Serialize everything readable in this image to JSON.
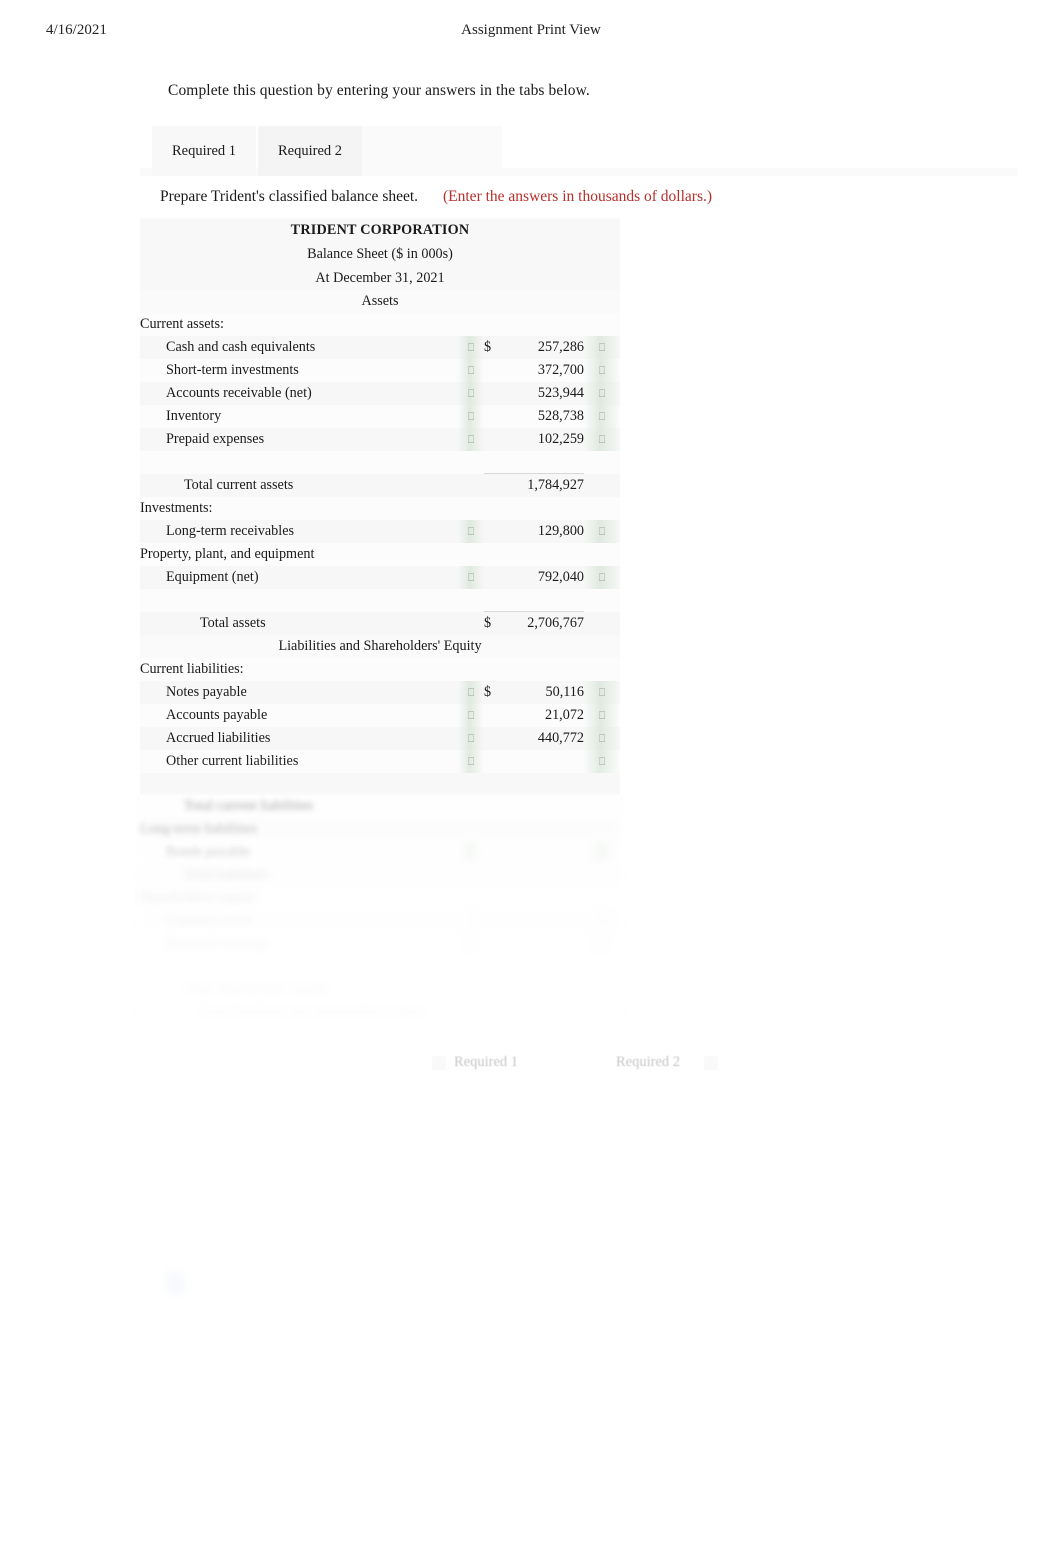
{
  "header": {
    "date": "4/16/2021",
    "title": "Assignment Print View"
  },
  "intro": "Complete this question by entering your answers in the tabs below.",
  "tabs": [
    {
      "label": "Required 1",
      "selected": false
    },
    {
      "label": "Required 2",
      "selected": true
    }
  ],
  "requirement": {
    "text": "Prepare Trident's classified balance sheet.",
    "note": "(Enter the answers in thousands of dollars.)",
    "note_color": "#b5302c"
  },
  "statement": {
    "company": "TRIDENT CORPORATION",
    "statement_name": "Balance Sheet ($ in 000s)",
    "date_line": "At December 31, 2021",
    "assets_heading": "Assets",
    "liabilities_heading": "Liabilities and Shareholders' Equity",
    "currency_symbol": "$",
    "marker_glyph": "⎕",
    "sections": [
      {
        "name": "current-assets",
        "heading": "Current assets:",
        "rows": [
          {
            "label": "Cash and cash equivalents",
            "currency": "$",
            "value": "257,286",
            "marker": true
          },
          {
            "label": "Short-term investments",
            "currency": "",
            "value": "372,700",
            "marker": true
          },
          {
            "label": "Accounts receivable (net)",
            "currency": "",
            "value": "523,944",
            "marker": true
          },
          {
            "label": "Inventory",
            "currency": "",
            "value": "528,738",
            "marker": true
          },
          {
            "label": "Prepaid expenses",
            "currency": "",
            "value": "102,259",
            "marker": true
          }
        ],
        "total": {
          "label": "Total current assets",
          "currency": "",
          "value": "1,784,927"
        }
      },
      {
        "name": "investments",
        "heading": "Investments:",
        "rows": [
          {
            "label": "Long-term receivables",
            "currency": "",
            "value": "129,800",
            "marker": true
          }
        ]
      },
      {
        "name": "ppe",
        "heading": "Property, plant, and equipment",
        "rows": [
          {
            "label": "Equipment (net)",
            "currency": "",
            "value": "792,040",
            "marker": true
          }
        ]
      }
    ],
    "total_assets": {
      "label": "Total assets",
      "currency": "$",
      "value": "2,706,767"
    },
    "liabilities": {
      "heading": "Current liabilities:",
      "rows": [
        {
          "label": "Notes payable",
          "currency": "$",
          "value": "50,116",
          "marker": true
        },
        {
          "label": "Accounts payable",
          "currency": "",
          "value": "21,072",
          "marker": true
        },
        {
          "label": "Accrued liabilities",
          "currency": "",
          "value": "440,772",
          "marker": true
        },
        {
          "label": "Other current liabilities",
          "currency": "",
          "value": "",
          "marker": true
        }
      ]
    },
    "faded_rows": [
      {
        "label": "Total current liabilities",
        "currency": "",
        "value": ""
      },
      {
        "label": "Long-term liabilities",
        "currency": "",
        "value": ""
      },
      {
        "label": "Bonds payable",
        "currency": "",
        "value": ""
      },
      {
        "label": "Total liabilities",
        "currency": "",
        "value": ""
      },
      {
        "label": "Shareholders' equity",
        "currency": "",
        "value": ""
      },
      {
        "label": "Common stock",
        "currency": "",
        "value": ""
      },
      {
        "label": "Retained earnings",
        "currency": "",
        "value": ""
      },
      {
        "label": "Total shareholders' equity",
        "currency": "",
        "value": ""
      },
      {
        "label": "Total liabilities and shareholders' equity",
        "currency": "",
        "value": ""
      }
    ]
  },
  "bottom_nav": [
    {
      "label": "Required 1"
    },
    {
      "label": "Required 2"
    }
  ]
}
